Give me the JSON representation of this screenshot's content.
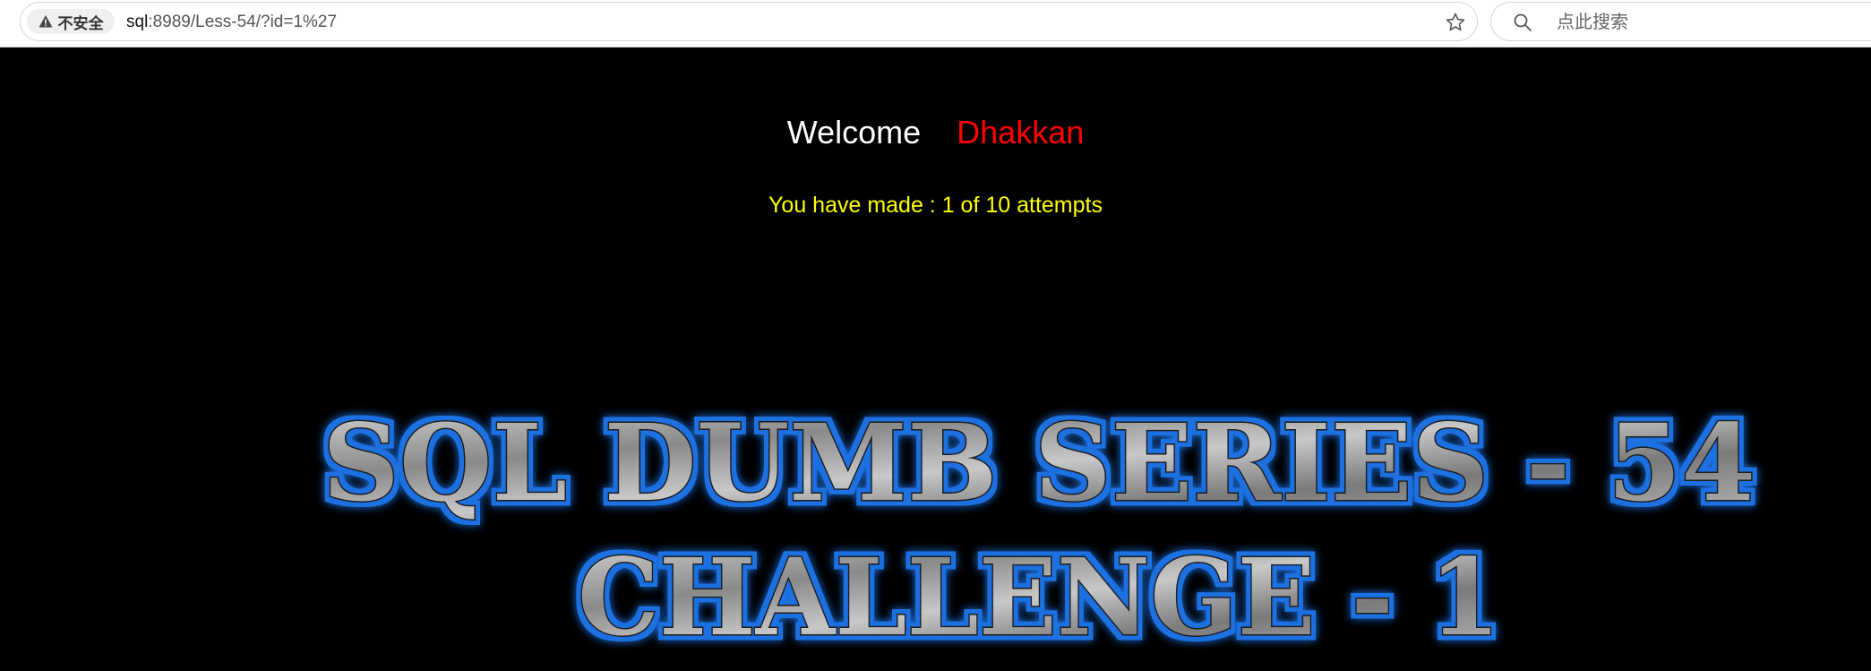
{
  "browser": {
    "security_label": "不安全",
    "url_host": "sql",
    "url_rest": ":8989/Less-54/?id=1%27",
    "search_placeholder": "点此搜索"
  },
  "page": {
    "welcome_label": "Welcome",
    "user_name": "Dhakkan",
    "attempts_text": "You have made : 1 of 10 attempts",
    "banner_line1": "SQL DUMB SERIES - 54",
    "banner_line2": "CHALLENGE - 1"
  },
  "colors": {
    "background": "#000000",
    "welcome": "#ffffff",
    "user_name": "#ff0000",
    "attempts": "#ffff00",
    "banner_glow": "#1e6fe0"
  }
}
